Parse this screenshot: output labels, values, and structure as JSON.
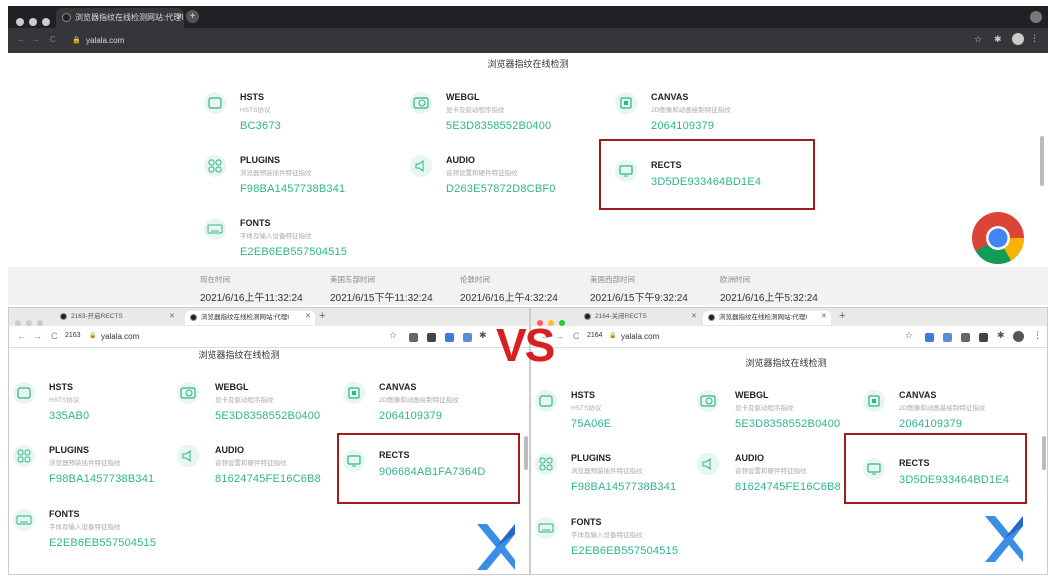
{
  "top_window": {
    "tab_title": "浏览器指纹在线检测网站:代理IP",
    "url": "yalala.com",
    "page_title": "浏览器指纹在线检测",
    "cards": [
      {
        "key": "hsts",
        "label": "HSTS",
        "desc": "HSTS协议",
        "value": "BC3673",
        "icon": "hsts-icon"
      },
      {
        "key": "webgl",
        "label": "WEBGL",
        "desc": "显卡及驱动程序指纹",
        "value": "5E3D8358552B0400",
        "icon": "gpu-icon"
      },
      {
        "key": "canvas",
        "label": "CANVAS",
        "desc": "2D图像和动画绘制特征指纹",
        "value": "2064109379",
        "icon": "chip-icon"
      },
      {
        "key": "plugins",
        "label": "PLUGINS",
        "desc": "浏览器预装插件特征指纹",
        "value": "F98BA1457738B341",
        "icon": "plugins-icon"
      },
      {
        "key": "audio",
        "label": "AUDIO",
        "desc": "音频设置和硬件特征指纹",
        "value": "D263E57872D8CBF0",
        "icon": "audio-icon"
      },
      {
        "key": "rects",
        "label": "RECTS",
        "desc": "",
        "value": "3D5DE933464BD1E4",
        "icon": "monitor-icon"
      },
      {
        "key": "fonts",
        "label": "FONTS",
        "desc": "字体及输入设备特征指纹",
        "value": "E2EB6EB557504515",
        "icon": "keyboard-icon"
      }
    ],
    "times": [
      {
        "label": "现在时间",
        "value": "2021/6/16上午11:32:24"
      },
      {
        "label": "美国东部时间",
        "value": "2021/6/15下午11:32:24"
      },
      {
        "label": "伦敦时间",
        "value": "2021/6/16上午4:32:24"
      },
      {
        "label": "美国西部时间",
        "value": "2021/6/15下午9:32:24"
      },
      {
        "label": "欧洲时间",
        "value": "2021/6/16上午5:32:24"
      }
    ]
  },
  "left_window": {
    "tab1": "2163-开启RECTS",
    "tab2": "浏览器指纹在线检测网站:代理I",
    "profile": "2163",
    "url": "yalala.com",
    "page_title": "浏览器指纹在线检测",
    "cards": [
      {
        "label": "HSTS",
        "desc": "HSTS协议",
        "value": "335AB0"
      },
      {
        "label": "WEBGL",
        "desc": "显卡及驱动程序指纹",
        "value": "5E3D8358552B0400"
      },
      {
        "label": "CANVAS",
        "desc": "2D图像和动画绘制特征指纹",
        "value": "2064109379"
      },
      {
        "label": "PLUGINS",
        "desc": "浏览器预装插件特征指纹",
        "value": "F98BA1457738B341"
      },
      {
        "label": "AUDIO",
        "desc": "音频设置和硬件特征指纹",
        "value": "81624745FE16C6B8"
      },
      {
        "label": "RECTS",
        "desc": "",
        "value": "906684AB1FA7364D"
      },
      {
        "label": "FONTS",
        "desc": "字体及输入设备特征指纹",
        "value": "E2EB6EB557504515"
      }
    ]
  },
  "right_window": {
    "tab1": "2164-关闭RECTS",
    "tab2": "浏览器指纹在线检测网站:代理I",
    "profile": "2164",
    "url": "yalala.com",
    "page_title": "浏览器指纹在线检测",
    "cards": [
      {
        "label": "HSTS",
        "desc": "HSTS协议",
        "value": "75A06E"
      },
      {
        "label": "WEBGL",
        "desc": "显卡及驱动程序指纹",
        "value": "5E3D8358552B0400"
      },
      {
        "label": "CANVAS",
        "desc": "2D图像和动画基绘制特征指纹",
        "value": "2064109379"
      },
      {
        "label": "PLUGINS",
        "desc": "浏览器预装插件特征指纹",
        "value": "F98BA1457738B341"
      },
      {
        "label": "AUDIO",
        "desc": "音频设置和硬件特征指纹",
        "value": "81624745FE16C6B8"
      },
      {
        "label": "RECTS",
        "desc": "",
        "value": "3D5DE933464BD1E4"
      },
      {
        "label": "FONTS",
        "desc": "字体及输入设备特征指纹",
        "value": "E2EB6EB557504515"
      }
    ]
  },
  "vs_label": "VS",
  "colors": {
    "accent": "#2fb48c",
    "highlight": "#a11c1c",
    "vs": "#d8201f"
  }
}
